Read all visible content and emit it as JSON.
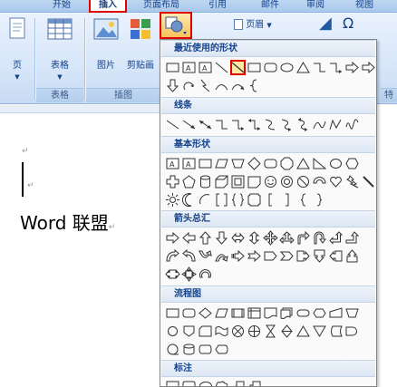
{
  "tabs": [
    "开始",
    "插入",
    "页面布局",
    "引用",
    "邮件",
    "审阅",
    "视图"
  ],
  "ribbon": {
    "page_label": "页",
    "table_label": "表格",
    "picture_label": "图片",
    "clipart_label": "剪贴画",
    "group_table": "表格",
    "group_illustrations": "插图",
    "header_label": "页眉",
    "right_group_fragment": "特"
  },
  "document": {
    "text": "Word 联盟",
    "para_mark": "↵"
  },
  "dropdown": {
    "sections": [
      "最近使用的形状",
      "线条",
      "基本形状",
      "箭头总汇",
      "流程图",
      "标注"
    ],
    "selected_shape": "line"
  }
}
